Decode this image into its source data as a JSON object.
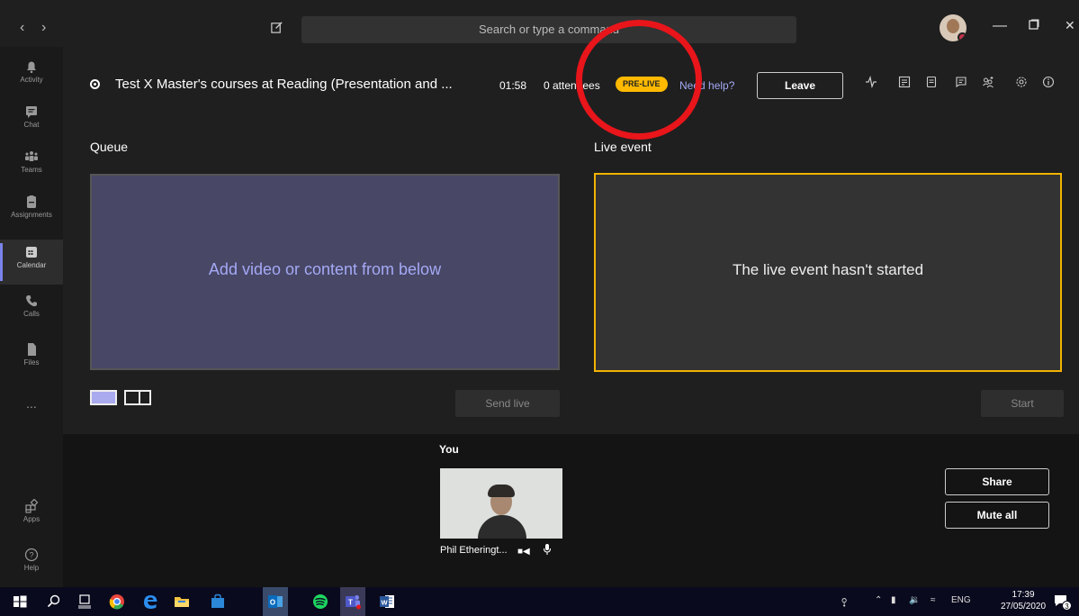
{
  "titlebar": {
    "search_placeholder": "Search or type a command",
    "back_icon": "chevron-left-icon",
    "forward_icon": "chevron-right-icon",
    "compose_icon": "new-chat-icon"
  },
  "rail": {
    "items": [
      {
        "label": "Activity",
        "icon": "bell-icon"
      },
      {
        "label": "Chat",
        "icon": "chat-icon"
      },
      {
        "label": "Teams",
        "icon": "teams-icon"
      },
      {
        "label": "Assignments",
        "icon": "assignments-icon"
      },
      {
        "label": "Calendar",
        "icon": "calendar-icon"
      },
      {
        "label": "Calls",
        "icon": "phone-icon"
      },
      {
        "label": "Files",
        "icon": "file-icon"
      },
      {
        "label": "...",
        "icon": "more-icon"
      },
      {
        "label": "Apps",
        "icon": "apps-icon"
      },
      {
        "label": "Help",
        "icon": "help-icon"
      }
    ]
  },
  "event": {
    "title": "Test X Master's courses at Reading (Presentation and ...",
    "timer": "01:58",
    "attendees": "0 attendees",
    "status_badge": "PRE-LIVE",
    "help_link": "Need help?",
    "leave_button": "Leave"
  },
  "queue": {
    "label": "Queue",
    "placeholder": "Add video or content from below",
    "send_live_button": "Send live"
  },
  "live": {
    "label": "Live event",
    "status": "The live event hasn't started",
    "start_button": "Start"
  },
  "participants": {
    "you_label": "You",
    "name": "Phil Etheringt..."
  },
  "actions": {
    "share_button": "Share",
    "mute_all_button": "Mute all"
  },
  "taskbar": {
    "language": "ENG",
    "time": "17:39",
    "date": "27/05/2020",
    "notification_count": "3"
  },
  "colors": {
    "accent": "#7b83eb",
    "badge": "#ffb900",
    "live_border": "#f2b400",
    "annotation": "#e8151b"
  }
}
